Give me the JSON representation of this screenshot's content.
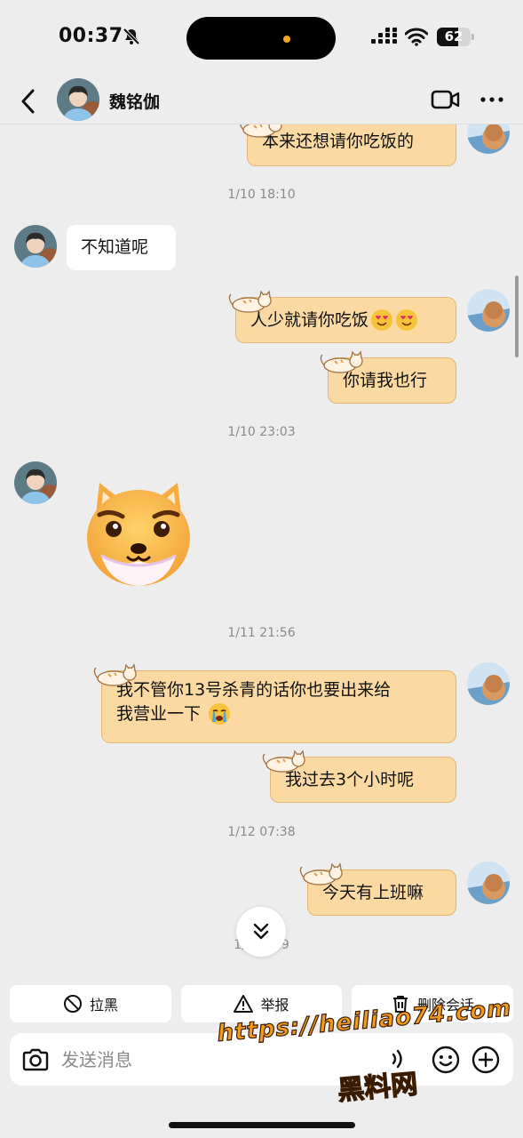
{
  "status": {
    "time": "00:37",
    "battery": "62",
    "battery_level": 0.62
  },
  "nav": {
    "contact_name": "魏铭伽"
  },
  "messages": {
    "m1": "本来还想请你吃饭的",
    "ts1": "1/10 18:10",
    "m2": "不知道呢",
    "m3": "人少就请你吃饭",
    "m4": "你请我也行",
    "ts2": "1/10 23:03",
    "ts3": "1/11 21:56",
    "m5_line1": "我不管你13号杀青的话你也要出来给",
    "m5_line2": "我营业一下",
    "m6": "我过去3个小时呢",
    "ts4": "1/12 07:38",
    "m7": "今天有上班嘛",
    "ts5": "1/12 ..19"
  },
  "actions": {
    "block": "拉黑",
    "report": "举报",
    "delete": "删除会话"
  },
  "composer": {
    "placeholder": "发送消息"
  },
  "watermark": {
    "url": "https://heiliao74.com",
    "name": "黑料网"
  },
  "colors": {
    "sent_bubble": "#fbd9a2",
    "received_bubble": "#ffffff",
    "background": "#ededed",
    "watermark": "#f29c1f"
  }
}
